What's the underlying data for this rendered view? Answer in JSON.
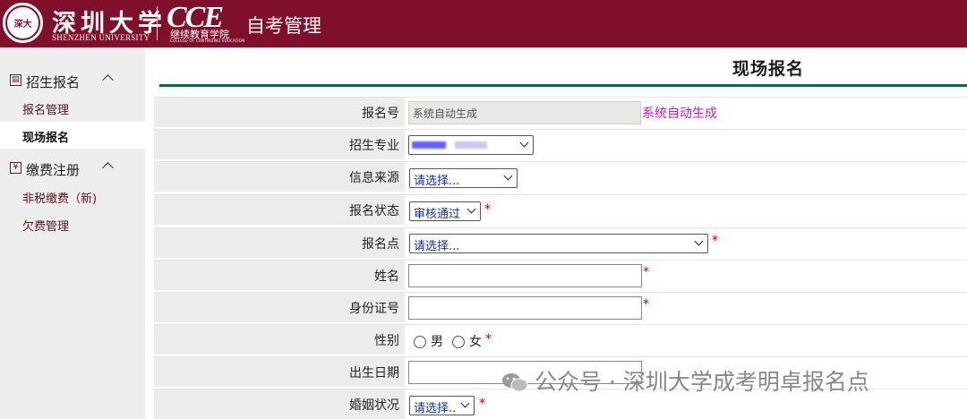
{
  "header": {
    "univ_name": "深圳大学",
    "univ_name_en": "SHENZHEN UNIVERSITY",
    "seal_text": "深大",
    "cce_logo": "CCE",
    "cce_cn": "继续教育学院",
    "cce_en": "COLLEGE OF CONTINUING EDUCATION",
    "app_title": "自考管理"
  },
  "sidebar": {
    "groups": [
      {
        "label": "招生报名",
        "items": [
          {
            "label": "报名管理"
          },
          {
            "label": "现场报名",
            "active": true
          }
        ]
      },
      {
        "label": "缴费注册",
        "items": [
          {
            "label": "非税缴费（新)"
          },
          {
            "label": "欠费管理"
          }
        ]
      }
    ]
  },
  "page": {
    "title": "现场报名"
  },
  "form": {
    "reg_no": {
      "label": "报名号",
      "value": "系统自动生成",
      "hint": "系统自动生成"
    },
    "major": {
      "label": "招生专业"
    },
    "info_source": {
      "label": "信息来源",
      "value": "请选择..."
    },
    "reg_status": {
      "label": "报名状态",
      "value": "审核通过"
    },
    "reg_point": {
      "label": "报名点",
      "value": "请选择..."
    },
    "name": {
      "label": "姓名",
      "value": ""
    },
    "id_number": {
      "label": "身份证号",
      "value": ""
    },
    "gender": {
      "label": "性别",
      "options": [
        "男",
        "女"
      ]
    },
    "birth_date": {
      "label": "出生日期",
      "value": ""
    },
    "marital_status": {
      "label": "婚姻状况",
      "value": "请选择.."
    },
    "required_mark": "*"
  },
  "watermark": {
    "text": "公众号 · 深圳大学成考明卓报名点"
  }
}
